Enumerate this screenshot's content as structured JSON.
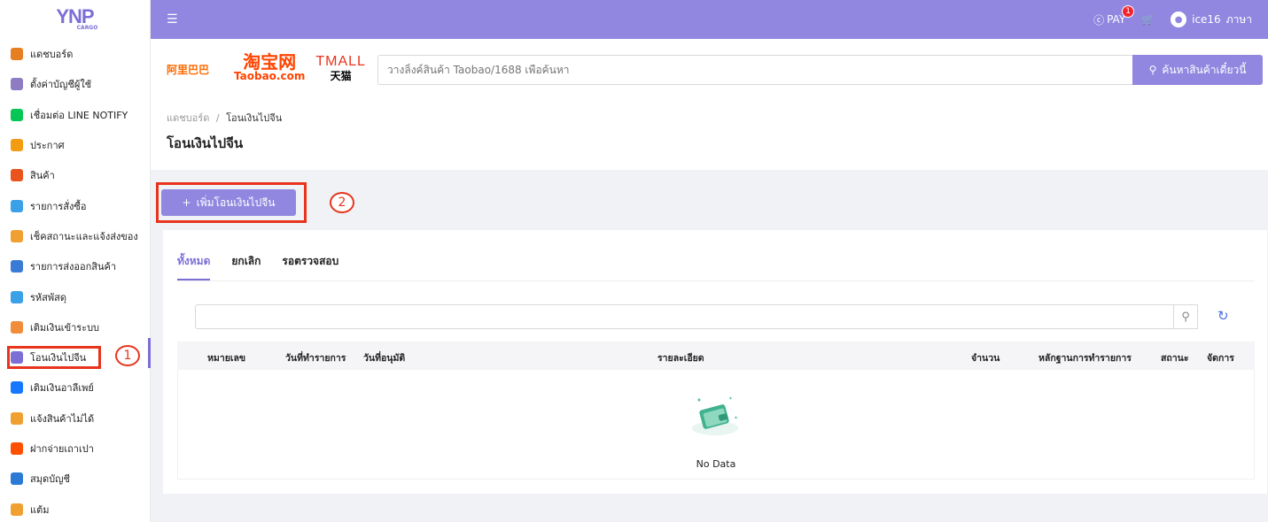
{
  "logo": {
    "main": "YNP",
    "sub": "CARGO"
  },
  "sidebar": {
    "items": [
      {
        "label": "แดชบอร์ด",
        "icon": "chart-icon",
        "color": "#e67e22"
      },
      {
        "label": "ตั้งค่าบัญชีผู้ใช้",
        "icon": "user-settings-icon",
        "color": "#8e7cc3"
      },
      {
        "label": "เชื่อมต่อ LINE NOTIFY",
        "icon": "line-icon",
        "color": "#06c755"
      },
      {
        "label": "ประกาศ",
        "icon": "megaphone-icon",
        "color": "#f39c12"
      },
      {
        "label": "สินค้า",
        "icon": "shopping-bag-icon",
        "color": "#e8541c"
      },
      {
        "label": "รายการสั่งซื้อ",
        "icon": "basket-icon",
        "color": "#3aa0e8"
      },
      {
        "label": "เช็คสถานะและแจ้งส่งของ",
        "icon": "truck-icon",
        "color": "#f0a030"
      },
      {
        "label": "รายการส่งออกสินค้า",
        "icon": "trolley-icon",
        "color": "#3a7bd5"
      },
      {
        "label": "รหัสพัสดุ",
        "icon": "box-icon",
        "color": "#3aa0e8"
      },
      {
        "label": "เติมเงินเข้าระบบ",
        "icon": "piggy-bank-icon",
        "color": "#f08c3a"
      },
      {
        "label": "โอนเงินไปจีน",
        "icon": "yuan-icon",
        "color": "#7b6fd6"
      },
      {
        "label": "เติมเงินอาลีเพย์",
        "icon": "alipay-icon",
        "color": "#1677ff"
      },
      {
        "label": "แจ้งสินค้าไม่ได้",
        "icon": "no-box-icon",
        "color": "#f0a030"
      },
      {
        "label": "ฝากจ่ายเถาเปา",
        "icon": "taobao-icon",
        "color": "#ff5000"
      },
      {
        "label": "สมุดบัญชี",
        "icon": "wallet-icon",
        "color": "#2d7ad6"
      },
      {
        "label": "แต้ม",
        "icon": "medal-icon",
        "color": "#f0a030"
      }
    ],
    "active_index": 10
  },
  "callouts": {
    "one": "1",
    "two": "2"
  },
  "topbar": {
    "collapse_icon": "menu-fold-icon",
    "pay_label": "PAY",
    "pay_badge": "1",
    "username": "ice16",
    "language": "ภาษา"
  },
  "brands": {
    "b1688": "阿里巴巴",
    "taobao_cn": "淘宝网",
    "taobao_en": "Taobao.com",
    "tmall_en": "TMALL",
    "tmall_cn": "天猫"
  },
  "search": {
    "placeholder": "วางลิ้งค์สินค้า Taobao/1688 เพื่อค้นหา",
    "button_label": "ค้นหาสินค้าเดี๋ยวนี้"
  },
  "breadcrumb": {
    "home": "แดชบอร์ด",
    "separator": "/",
    "current": "โอนเงินไปจีน"
  },
  "page_title": "โอนเงินไปจีน",
  "add_button": {
    "label": "เพิ่มโอนเงินไปจีน"
  },
  "tabs": [
    {
      "label": "ทั้งหมด",
      "active": true
    },
    {
      "label": "ยกเลิก",
      "active": false
    },
    {
      "label": "รอตรวจสอบ",
      "active": false
    }
  ],
  "table": {
    "columns": [
      "หมายเลข",
      "วันที่ทำรายการ",
      "วันที่อนุมัติ",
      "รายละเอียด",
      "จำนวน",
      "หลักฐานการทำรายการ",
      "สถานะ",
      "จัดการ"
    ],
    "empty_text": "No Data"
  }
}
